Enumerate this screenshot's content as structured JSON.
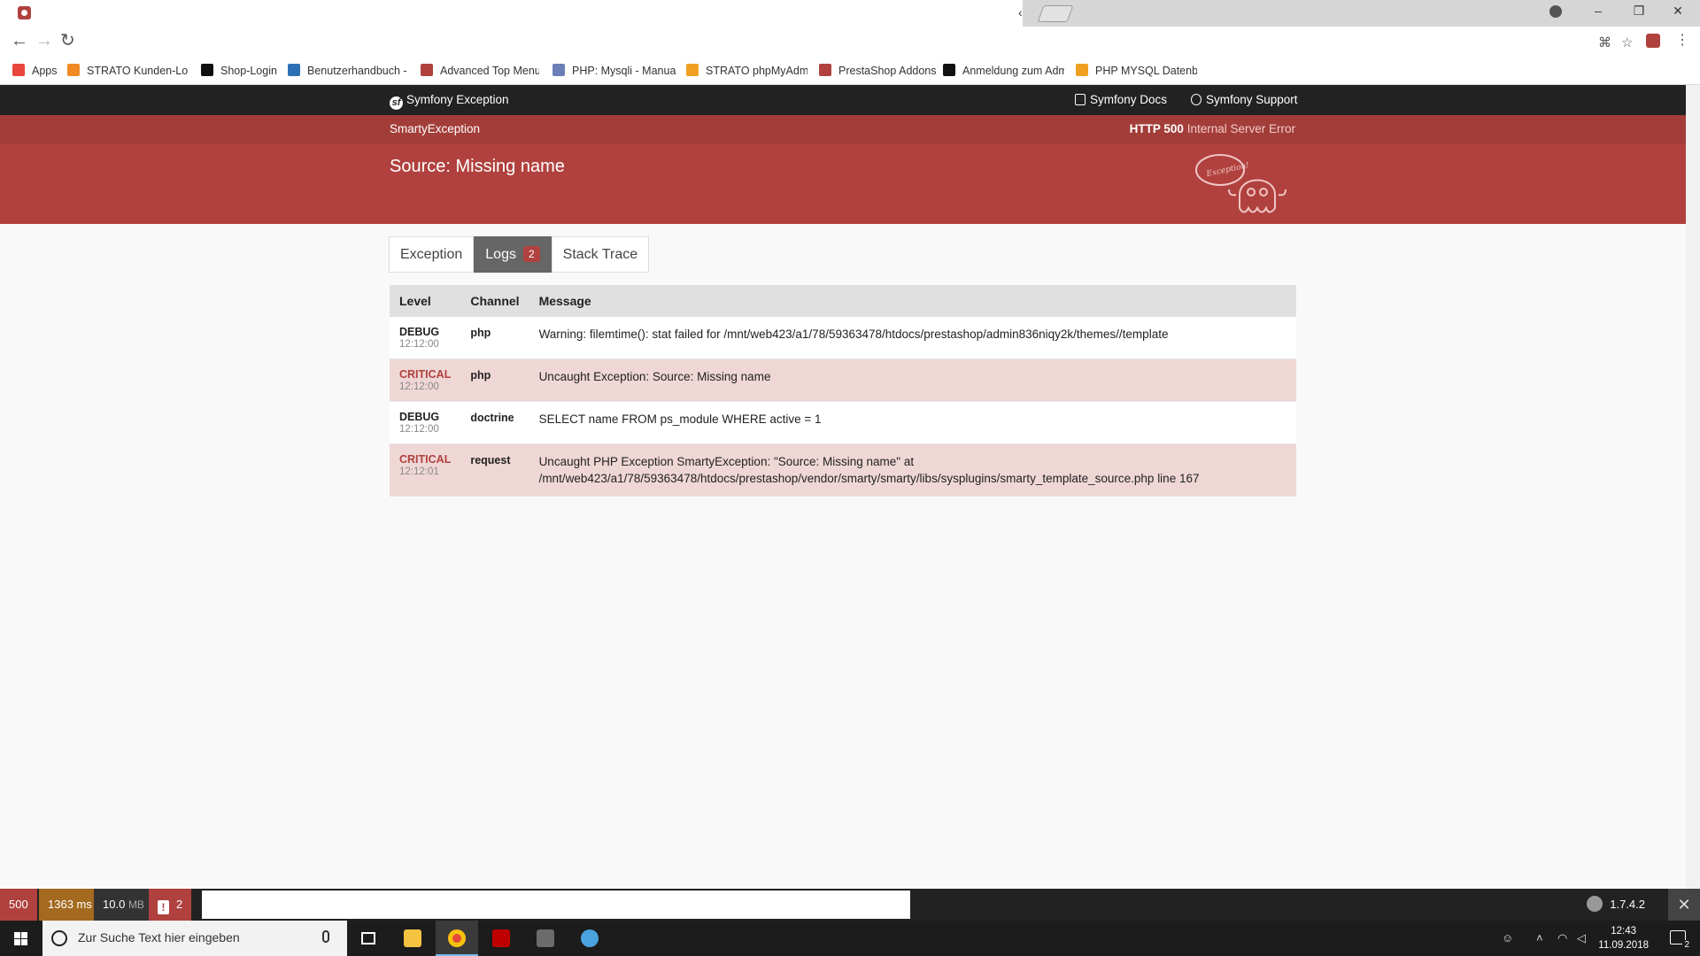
{
  "browser": {
    "bookmarks": [
      {
        "label": "Apps",
        "color": "#e8453c"
      },
      {
        "label": "STRATO Kunden-Log",
        "color": "#f08a24"
      },
      {
        "label": "Shop-Login",
        "color": "#111111"
      },
      {
        "label": "Benutzerhandbuch -",
        "color": "#2c6fb5"
      },
      {
        "label": "Advanced Top Menu",
        "color": "#b0413e"
      },
      {
        "label": "PHP: Mysqli - Manual",
        "color": "#6c7eb7"
      },
      {
        "label": "STRATO phpMyAdm",
        "color": "#f0a020"
      },
      {
        "label": "PrestaShop Addons",
        "color": "#b0413e"
      },
      {
        "label": "Anmeldung zum Adm",
        "color": "#111111"
      },
      {
        "label": "PHP MYSQL Datenba",
        "color": "#f0a020"
      }
    ]
  },
  "header": {
    "title": "Symfony Exception",
    "docs": "Symfony Docs",
    "support": "Symfony Support"
  },
  "summary": {
    "exception_class": "SmartyException",
    "http_code": "HTTP 500",
    "http_text": "Internal Server Error",
    "message": "Source: Missing name",
    "ghost_label": "Exception!"
  },
  "tabs": [
    {
      "label": "Exception"
    },
    {
      "label": "Logs",
      "badge": "2"
    },
    {
      "label": "Stack Trace"
    }
  ],
  "logs": {
    "headers": [
      "Level",
      "Channel",
      "Message"
    ],
    "rows": [
      {
        "level": "DEBUG",
        "time": "12:12:00",
        "channel": "php",
        "message": "Warning: filemtime(): stat failed for /mnt/web423/a1/78/59363478/htdocs/prestashop/admin836niqy2k/themes//template"
      },
      {
        "level": "CRITICAL",
        "time": "12:12:00",
        "channel": "php",
        "message": "Uncaught Exception: Source: Missing name"
      },
      {
        "level": "DEBUG",
        "time": "12:12:00",
        "channel": "doctrine",
        "message": "SELECT name FROM ps_module WHERE active = 1"
      },
      {
        "level": "CRITICAL",
        "time": "12:12:01",
        "channel": "request",
        "message": "Uncaught PHP Exception SmartyException: \"Source: Missing name\" at /mnt/web423/a1/78/59363478/htdocs/prestashop/vendor/smarty/smarty/libs/sysplugins/smarty_template_source.php line 167"
      }
    ]
  },
  "debug_toolbar": {
    "status": "500",
    "time": "1363 ms",
    "memory_value": "10.0",
    "memory_unit": "MB",
    "errors": "2",
    "version": "1.7.4.2"
  },
  "taskbar": {
    "search_placeholder": "Zur Suche Text hier eingeben",
    "time": "12:43",
    "date": "11.09.2018",
    "notifications": "2"
  }
}
